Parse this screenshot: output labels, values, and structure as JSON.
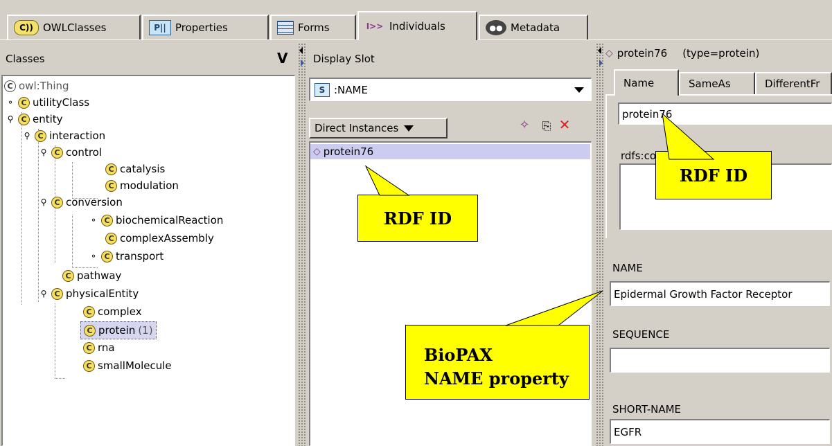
{
  "tabs": [
    {
      "label": "OWLClasses",
      "icon": "owl-classes-icon",
      "icon_text": "C))"
    },
    {
      "label": "Properties",
      "icon": "properties-icon",
      "icon_text": "P||"
    },
    {
      "label": "Forms",
      "icon": "forms-icon",
      "icon_text": ""
    },
    {
      "label": "Individuals",
      "icon": "individuals-icon",
      "icon_text": "I>>"
    },
    {
      "label": "Metadata",
      "icon": "metadata-icon",
      "icon_text": "●●"
    }
  ],
  "classes_panel": {
    "title": "Classes",
    "toggle": "V",
    "tree": [
      {
        "label": "owl:Thing",
        "expander": ""
      },
      {
        "label": "utilityClass",
        "expander": "⚬"
      },
      {
        "label": "entity",
        "expander": "⚲"
      },
      {
        "label": "interaction",
        "expander": "⚲"
      },
      {
        "label": "control",
        "expander": "⚲"
      },
      {
        "label": "catalysis",
        "expander": ""
      },
      {
        "label": "modulation",
        "expander": ""
      },
      {
        "label": "conversion",
        "expander": "⚲"
      },
      {
        "label": "biochemicalReaction",
        "expander": "⚬"
      },
      {
        "label": "complexAssembly",
        "expander": ""
      },
      {
        "label": "transport",
        "expander": "⚬"
      },
      {
        "label": "pathway",
        "expander": ""
      },
      {
        "label": "physicalEntity",
        "expander": "⚲"
      },
      {
        "label": "complex",
        "expander": ""
      },
      {
        "label": "protein",
        "expander": "",
        "count": "(1)",
        "selected": true
      },
      {
        "label": "rna",
        "expander": ""
      },
      {
        "label": "smallMolecule",
        "expander": ""
      }
    ]
  },
  "instances_panel": {
    "display_slot_label": "Display Slot",
    "slot_icon": "S",
    "slot_value": ":NAME",
    "direct_instances_label": "Direct Instances",
    "instances": [
      "protein76"
    ]
  },
  "form_panel": {
    "header_name": "protein76",
    "header_type": "(type=protein)",
    "tabs": [
      "Name",
      "SameAs",
      "DifferentFr"
    ],
    "name_value": "protein76",
    "comment_label": "rdfs:comment",
    "properties": [
      {
        "label": "NAME",
        "value": "Epidermal Growth Factor Receptor"
      },
      {
        "label": "SEQUENCE",
        "value": ""
      },
      {
        "label": "SHORT-NAME",
        "value": "EGFR"
      }
    ]
  },
  "callouts": {
    "rdf_id_middle": "RDF ID",
    "rdf_id_right": "RDF ID",
    "biopax_line1": "BioPAX",
    "biopax_line2": "NAME property"
  },
  "colors": {
    "chrome": "#d4d0c8",
    "selection": "#ccccf0",
    "callout": "#ffff00",
    "class_icon": "#f5de62"
  }
}
